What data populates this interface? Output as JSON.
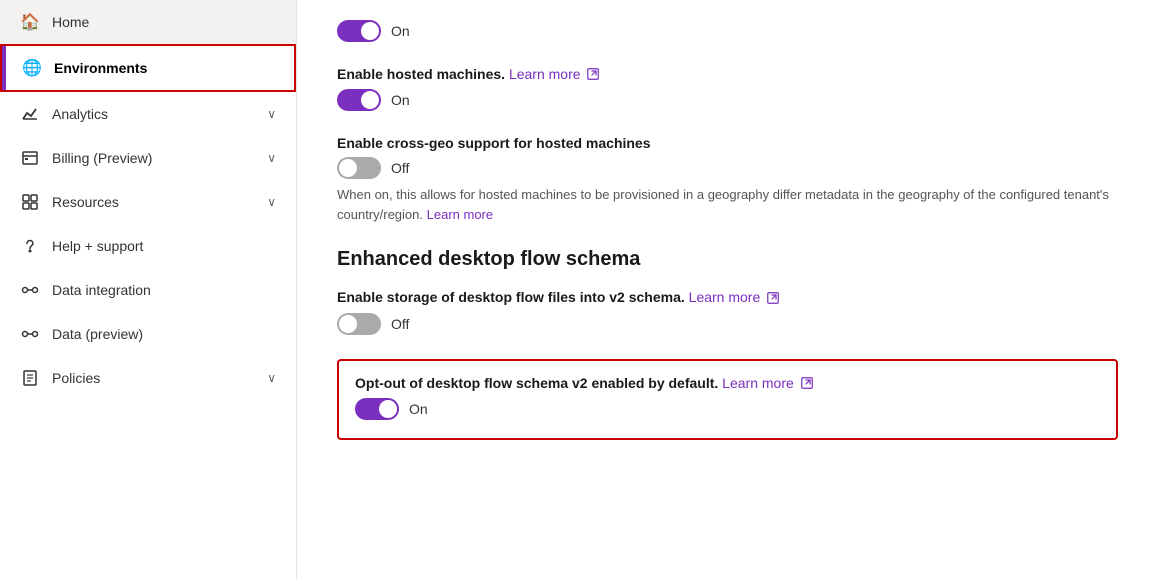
{
  "sidebar": {
    "items": [
      {
        "id": "home",
        "label": "Home",
        "icon": "🏠",
        "active": false,
        "hasChevron": false
      },
      {
        "id": "environments",
        "label": "Environments",
        "icon": "🌐",
        "active": true,
        "hasChevron": false
      },
      {
        "id": "analytics",
        "label": "Analytics",
        "icon": "📈",
        "active": false,
        "hasChevron": true
      },
      {
        "id": "billing",
        "label": "Billing (Preview)",
        "icon": "⊞",
        "active": false,
        "hasChevron": true
      },
      {
        "id": "resources",
        "label": "Resources",
        "icon": "⊞",
        "active": false,
        "hasChevron": true
      },
      {
        "id": "help",
        "label": "Help + support",
        "icon": "🎧",
        "active": false,
        "hasChevron": false
      },
      {
        "id": "data-integration",
        "label": "Data integration",
        "icon": "🔗",
        "active": false,
        "hasChevron": false
      },
      {
        "id": "data-preview",
        "label": "Data (preview)",
        "icon": "🔗",
        "active": false,
        "hasChevron": false
      },
      {
        "id": "policies",
        "label": "Policies",
        "icon": "📋",
        "active": false,
        "hasChevron": true
      }
    ]
  },
  "main": {
    "top_toggle_1": {
      "state": "on",
      "label": "On"
    },
    "hosted_machines": {
      "label": "Enable hosted machines.",
      "learn_more": "Learn more",
      "toggle_state": "on",
      "toggle_label": "On"
    },
    "cross_geo": {
      "label": "Enable cross-geo support for hosted machines",
      "toggle_state": "off",
      "toggle_label": "Off",
      "description": "When on, this allows for hosted machines to be provisioned in a geography differ metadata in the geography of the configured tenant's country/region.",
      "learn_more": "Learn more"
    },
    "section_title": "Enhanced desktop flow schema",
    "storage_v2": {
      "label": "Enable storage of desktop flow files into v2 schema.",
      "learn_more": "Learn more",
      "toggle_state": "off",
      "toggle_label": "Off"
    },
    "opt_out": {
      "label": "Opt-out of desktop flow schema v2 enabled by default.",
      "learn_more": "Learn more",
      "toggle_state": "on",
      "toggle_label": "On"
    }
  }
}
